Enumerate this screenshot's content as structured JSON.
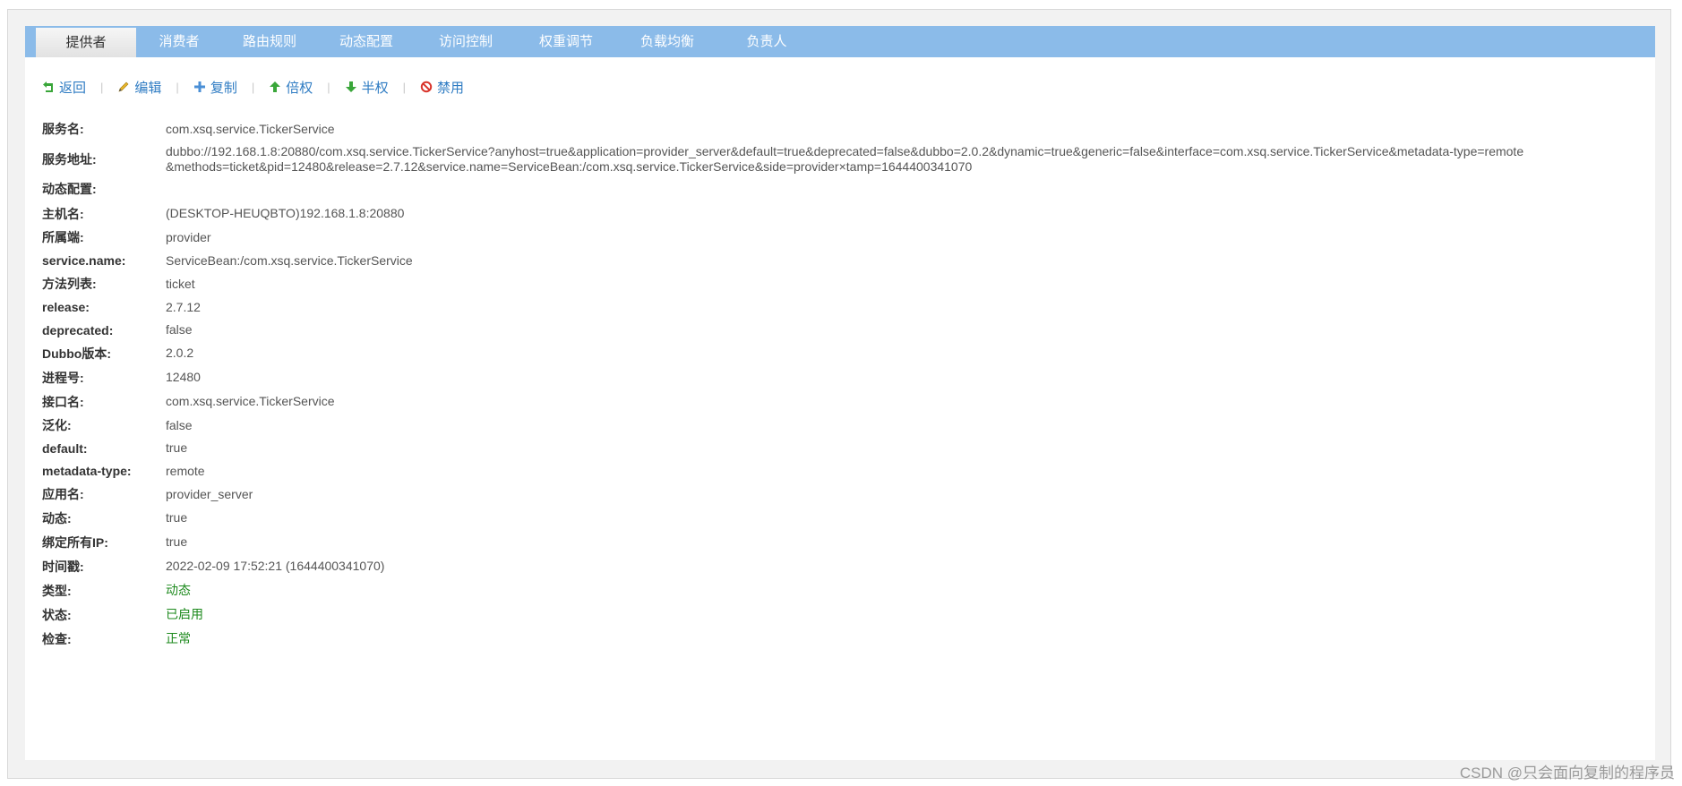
{
  "tabs": [
    {
      "label": "提供者",
      "active": true
    },
    {
      "label": "消费者",
      "active": false
    },
    {
      "label": "路由规则",
      "active": false
    },
    {
      "label": "动态配置",
      "active": false
    },
    {
      "label": "访问控制",
      "active": false
    },
    {
      "label": "权重调节",
      "active": false
    },
    {
      "label": "负载均衡",
      "active": false
    },
    {
      "label": "负责人",
      "active": false
    }
  ],
  "toolbar": {
    "back_label": "返回",
    "edit_label": "编辑",
    "copy_label": "复制",
    "double_label": "倍权",
    "half_label": "半权",
    "disable_label": "禁用",
    "separator": "|"
  },
  "details": {
    "service_name": {
      "label": "服务名:",
      "value": "com.xsq.service.TickerService"
    },
    "service_url": {
      "label": "服务地址:",
      "line1": "dubbo://192.168.1.8:20880/com.xsq.service.TickerService?anyhost=true&application=provider_server&default=true&deprecated=false&dubbo=2.0.2&dynamic=true&generic=false&interface=com.xsq.service.TickerService&metadata-type=remote",
      "line2": "&methods=ticket&pid=12480&release=2.7.12&service.name=ServiceBean:/com.xsq.service.TickerService&side=provider×tamp=1644400341070"
    },
    "dynamic_config": {
      "label": "动态配置:",
      "value": ""
    },
    "host": {
      "label": "主机名:",
      "value": "(DESKTOP-HEUQBTO)192.168.1.8:20880"
    },
    "side": {
      "label": "所属端:",
      "value": "provider"
    },
    "service_name_param": {
      "label": "service.name:",
      "value": "ServiceBean:/com.xsq.service.TickerService"
    },
    "methods": {
      "label": "方法列表:",
      "value": "ticket"
    },
    "release": {
      "label": "release:",
      "value": "2.7.12"
    },
    "deprecated": {
      "label": "deprecated:",
      "value": "false"
    },
    "dubbo_version": {
      "label": "Dubbo版本:",
      "value": "2.0.2"
    },
    "pid": {
      "label": "进程号:",
      "value": "12480"
    },
    "interface": {
      "label": "接口名:",
      "value": "com.xsq.service.TickerService"
    },
    "generic": {
      "label": "泛化:",
      "value": "false"
    },
    "default": {
      "label": "default:",
      "value": "true"
    },
    "metadata_type": {
      "label": "metadata-type:",
      "value": "remote"
    },
    "application": {
      "label": "应用名:",
      "value": "provider_server"
    },
    "dynamic": {
      "label": "动态:",
      "value": "true"
    },
    "anyhost": {
      "label": "绑定所有IP:",
      "value": "true"
    },
    "timestamp": {
      "label": "时间戳:",
      "value": "2022-02-09 17:52:21 (1644400341070)"
    },
    "type": {
      "label": "类型:",
      "value": "动态"
    },
    "status": {
      "label": "状态:",
      "value": "已启用"
    },
    "check": {
      "label": "检查:",
      "value": "正常"
    }
  },
  "colors": {
    "tab_bar": "#8bbbe9",
    "link": "#2f7cc3",
    "ok_green": "#1e8a1e"
  },
  "icons": {
    "back": "return-arrow-icon",
    "edit": "pencil-icon",
    "copy": "plus-icon",
    "double": "arrow-up-icon",
    "half": "arrow-down-icon",
    "disable": "forbidden-icon"
  },
  "watermark": "CSDN @只会面向复制的程序员"
}
